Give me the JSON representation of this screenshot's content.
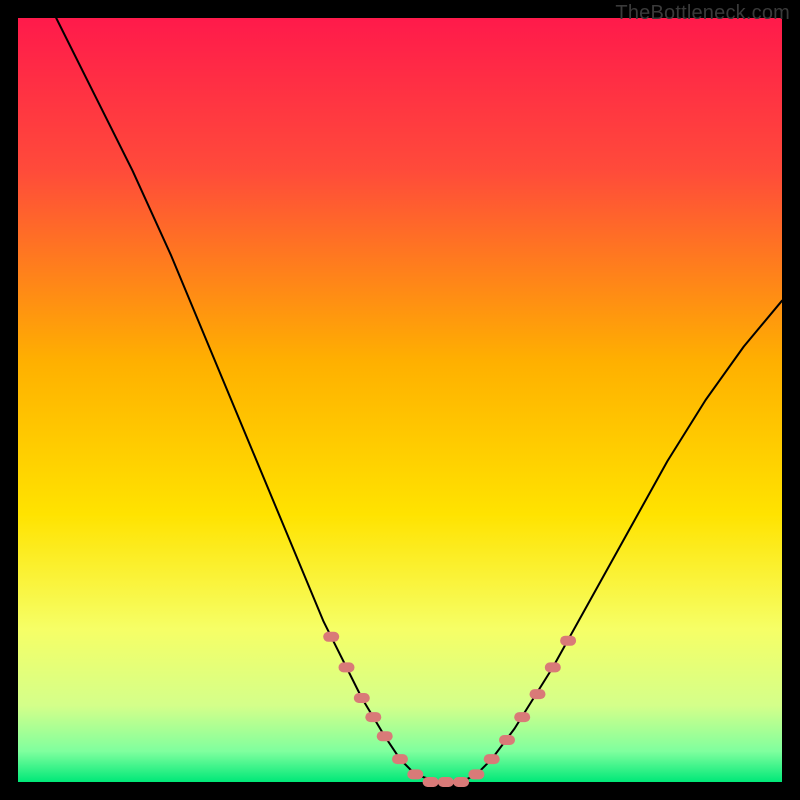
{
  "watermark": "TheBottleneck.com",
  "chart_data": {
    "type": "line",
    "title": "",
    "xlabel": "",
    "ylabel": "",
    "xlim": [
      0,
      100
    ],
    "ylim": [
      0,
      100
    ],
    "series": [
      {
        "name": "bottleneck-curve",
        "x": [
          5,
          10,
          15,
          20,
          25,
          30,
          35,
          40,
          45,
          48,
          50,
          52,
          55,
          58,
          60,
          62,
          65,
          70,
          75,
          80,
          85,
          90,
          95,
          100
        ],
        "values": [
          100,
          90,
          80,
          69,
          57,
          45,
          33,
          21,
          11,
          6,
          3,
          1,
          0,
          0,
          1,
          3,
          7,
          15,
          24,
          33,
          42,
          50,
          57,
          63
        ]
      }
    ],
    "markers": {
      "name": "highlighted-points",
      "color": "#d97a78",
      "x": [
        41,
        43,
        45,
        46.5,
        48,
        50,
        52,
        54,
        56,
        58,
        60,
        62,
        64,
        66,
        68,
        70,
        72
      ],
      "values": [
        19,
        15,
        11,
        8.5,
        6,
        3,
        1,
        0,
        0,
        0,
        1,
        3,
        5.5,
        8.5,
        11.5,
        15,
        18.5
      ]
    },
    "gradient_stops": [
      {
        "pct": 0,
        "color": "#ff1a4b"
      },
      {
        "pct": 20,
        "color": "#ff4b3a"
      },
      {
        "pct": 45,
        "color": "#ffb000"
      },
      {
        "pct": 65,
        "color": "#ffe300"
      },
      {
        "pct": 80,
        "color": "#f6ff66"
      },
      {
        "pct": 90,
        "color": "#d4ff8a"
      },
      {
        "pct": 96,
        "color": "#7fff9e"
      },
      {
        "pct": 100,
        "color": "#00e878"
      }
    ]
  }
}
